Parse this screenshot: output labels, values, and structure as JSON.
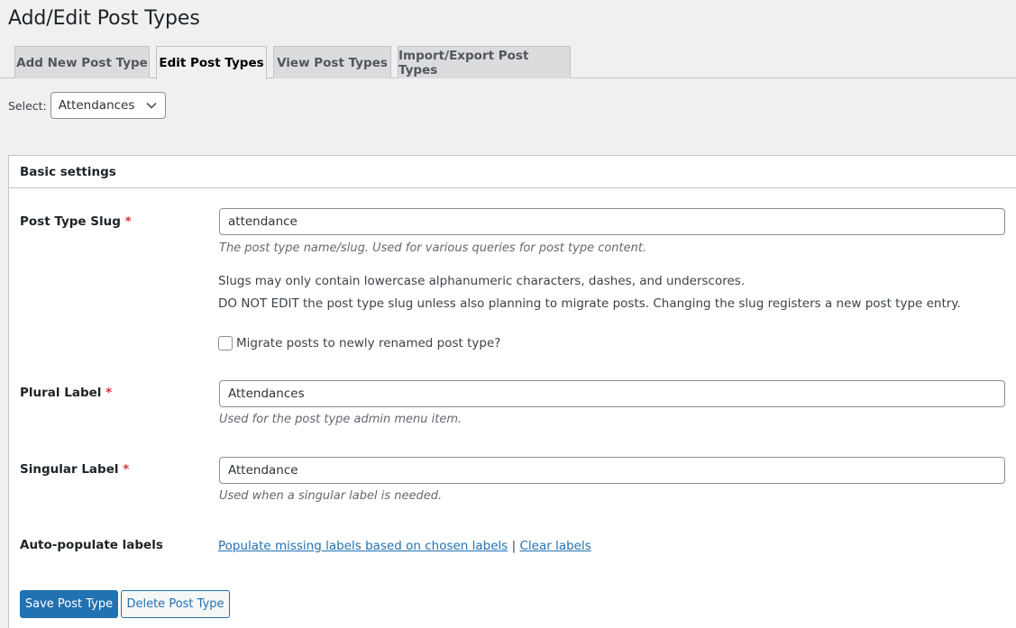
{
  "page": {
    "title": "Add/Edit Post Types"
  },
  "tabs": [
    {
      "label": "Add New Post Type",
      "active": false
    },
    {
      "label": "Edit Post Types",
      "active": true
    },
    {
      "label": "View Post Types",
      "active": false
    },
    {
      "label": "Import/Export Post Types",
      "active": false
    }
  ],
  "selector": {
    "label": "Select:",
    "value": "Attendances"
  },
  "panel": {
    "title": "Basic settings",
    "required_mark": "*",
    "slug": {
      "label": "Post Type Slug",
      "value": "attendance",
      "description": "The post type name/slug. Used for various queries for post type content.",
      "note1": "Slugs may only contain lowercase alphanumeric characters, dashes, and underscores.",
      "note2": "DO NOT EDIT the post type slug unless also planning to migrate posts. Changing the slug registers a new post type entry.",
      "migrate_label": "Migrate posts to newly renamed post type?",
      "migrate_checked": false
    },
    "plural": {
      "label": "Plural Label",
      "value": "Attendances",
      "description": "Used for the post type admin menu item."
    },
    "singular": {
      "label": "Singular Label",
      "value": "Attendance",
      "description": "Used when a singular label is needed."
    },
    "autopopulate": {
      "label": "Auto-populate labels",
      "populate_link": "Populate missing labels based on chosen labels",
      "separator": "|",
      "clear_link": "Clear labels"
    }
  },
  "buttons": {
    "save": "Save Post Type",
    "delete": "Delete Post Type"
  },
  "colors": {
    "primary": "#2271b1",
    "required": "#d63638",
    "background": "#f0f0f1"
  }
}
